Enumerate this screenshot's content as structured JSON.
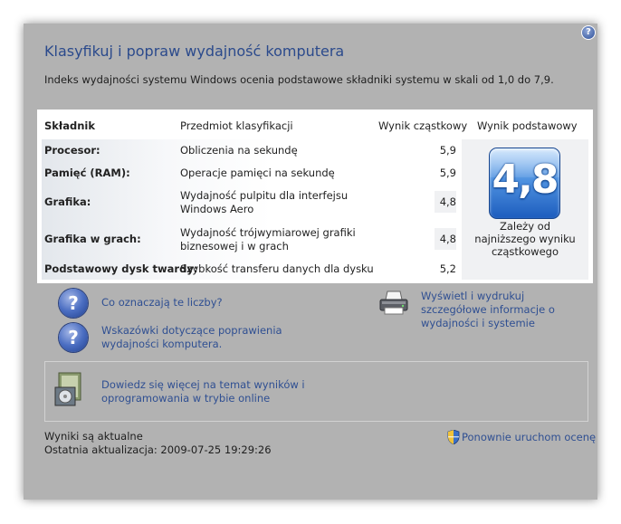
{
  "header": {
    "title": "Klasyfikuj i popraw wydajność komputera",
    "subtitle": "Indeks wydajności systemu Windows ocenia podstawowe składniki systemu w skali od 1,0 do 7,9."
  },
  "table": {
    "columns": [
      "Składnik",
      "Przedmiot klasyfikacji",
      "Wynik cząstkowy",
      "Wynik podstawowy"
    ],
    "rows": [
      {
        "component": "Procesor:",
        "subject": "Obliczenia na sekundę",
        "score": "5,9"
      },
      {
        "component": "Pamięć (RAM):",
        "subject": "Operacje pamięci na sekundę",
        "score": "5,9"
      },
      {
        "component": "Grafika:",
        "subject": "Wydajność pulpitu dla interfejsu Windows Aero",
        "score": "4,8"
      },
      {
        "component": "Grafika w grach:",
        "subject": "Wydajność trójwymiarowej grafiki biznesowej i w grach",
        "score": "4,8"
      },
      {
        "component": "Podstawowy dysk twardy:",
        "subject": "Szybkość transferu danych dla dysku",
        "score": "5,2"
      }
    ],
    "base_score": "4,8",
    "base_note": "Zależy od najniższego wyniku cząstkowego"
  },
  "links": {
    "what_numbers": "Co oznaczają te liczby?",
    "tips": "Wskazówki dotyczące poprawienia wydajności komputera.",
    "print_details": "Wyświetl i wydrukuj szczegółowe informacje o wydajności i systemie",
    "learn_more": "Dowiedz się więcej na temat wyników i oprogramowania w trybie online",
    "rerun": "Ponownie uruchom ocenę"
  },
  "status": {
    "current": "Wyniki są aktualne",
    "last_update": "Ostatnia aktualizacja: 2009-07-25 19:29:26"
  },
  "icons": {
    "help": "help-icon",
    "question": "question-icon",
    "printer": "printer-icon",
    "online": "online-info-icon",
    "shield": "shield-icon"
  },
  "colors": {
    "link": "#2f4f92",
    "title": "#2b4a8c",
    "window_bg": "#b2b2b2",
    "badge": "#2f73d4"
  }
}
